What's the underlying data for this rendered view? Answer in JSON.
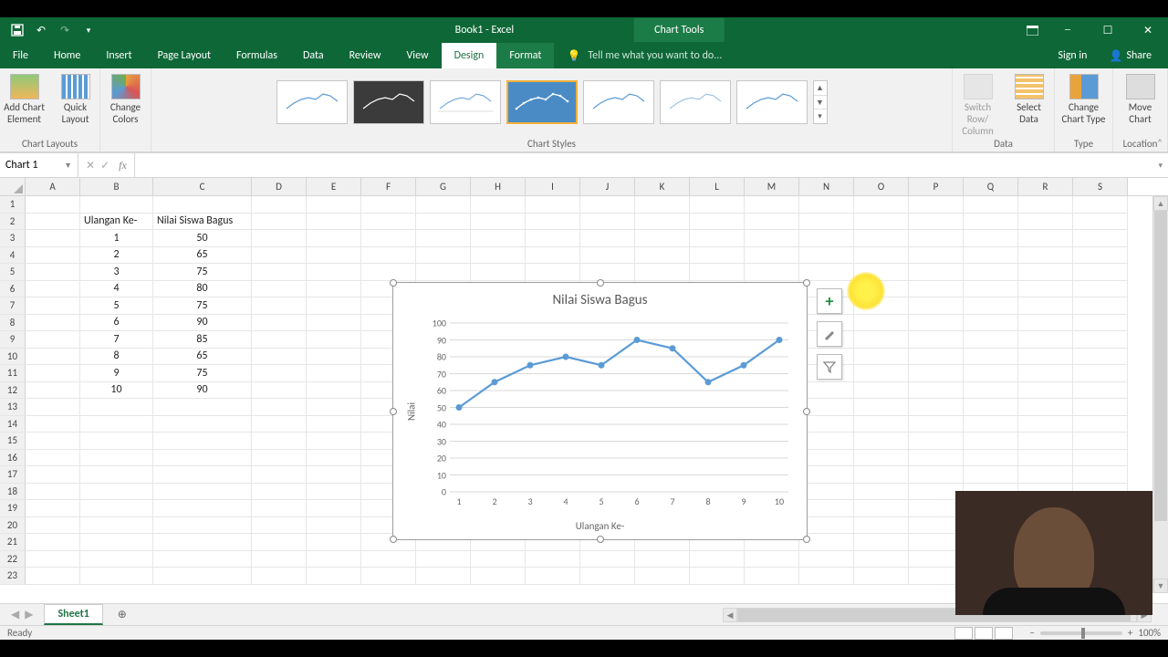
{
  "window": {
    "title": "Book1 - Excel",
    "contextual_tab": "Chart Tools"
  },
  "ribbon_tabs": [
    "File",
    "Home",
    "Insert",
    "Page Layout",
    "Formulas",
    "Data",
    "Review",
    "View",
    "Design",
    "Format"
  ],
  "active_ribbon_tab": "Design",
  "tellme_placeholder": "Tell me what you want to do...",
  "signin_label": "Sign in",
  "share_label": "Share",
  "ribbon_groups": {
    "chart_layouts": {
      "label": "Chart Layouts",
      "add_chart_element": "Add Chart Element",
      "quick_layout": "Quick Layout"
    },
    "change_colors": "Change Colors",
    "chart_styles_label": "Chart Styles",
    "switch_rc": "Switch Row/ Column",
    "select_data": "Select Data",
    "data_label": "Data",
    "change_chart_type": "Change Chart Type",
    "type_label": "Type",
    "move_chart": "Move Chart",
    "location_label": "Location"
  },
  "namebox_value": "Chart 1",
  "columns": [
    "A",
    "B",
    "C",
    "D",
    "E",
    "F",
    "G",
    "H",
    "I",
    "J",
    "K",
    "L",
    "M",
    "N",
    "O",
    "P",
    "Q",
    "R",
    "S"
  ],
  "table": {
    "header_b": "Ulangan Ke-",
    "header_c": "Nilai Siswa Bagus",
    "rows": [
      {
        "b": "1",
        "c": "50"
      },
      {
        "b": "2",
        "c": "65"
      },
      {
        "b": "3",
        "c": "75"
      },
      {
        "b": "4",
        "c": "80"
      },
      {
        "b": "5",
        "c": "75"
      },
      {
        "b": "6",
        "c": "90"
      },
      {
        "b": "7",
        "c": "85"
      },
      {
        "b": "8",
        "c": "65"
      },
      {
        "b": "9",
        "c": "75"
      },
      {
        "b": "10",
        "c": "90"
      }
    ]
  },
  "chart_data": {
    "type": "line",
    "title": "Nilai Siswa Bagus",
    "xlabel": "Ulangan Ke-",
    "ylabel": "Nilai",
    "x": [
      1,
      2,
      3,
      4,
      5,
      6,
      7,
      8,
      9,
      10
    ],
    "values": [
      50,
      65,
      75,
      80,
      75,
      90,
      85,
      65,
      75,
      90
    ],
    "ylim": [
      0,
      100
    ],
    "yticks": [
      0,
      10,
      20,
      30,
      40,
      50,
      60,
      70,
      80,
      90,
      100
    ]
  },
  "sheet_tab": "Sheet1",
  "status_text": "Ready",
  "zoom_pct": "100%"
}
